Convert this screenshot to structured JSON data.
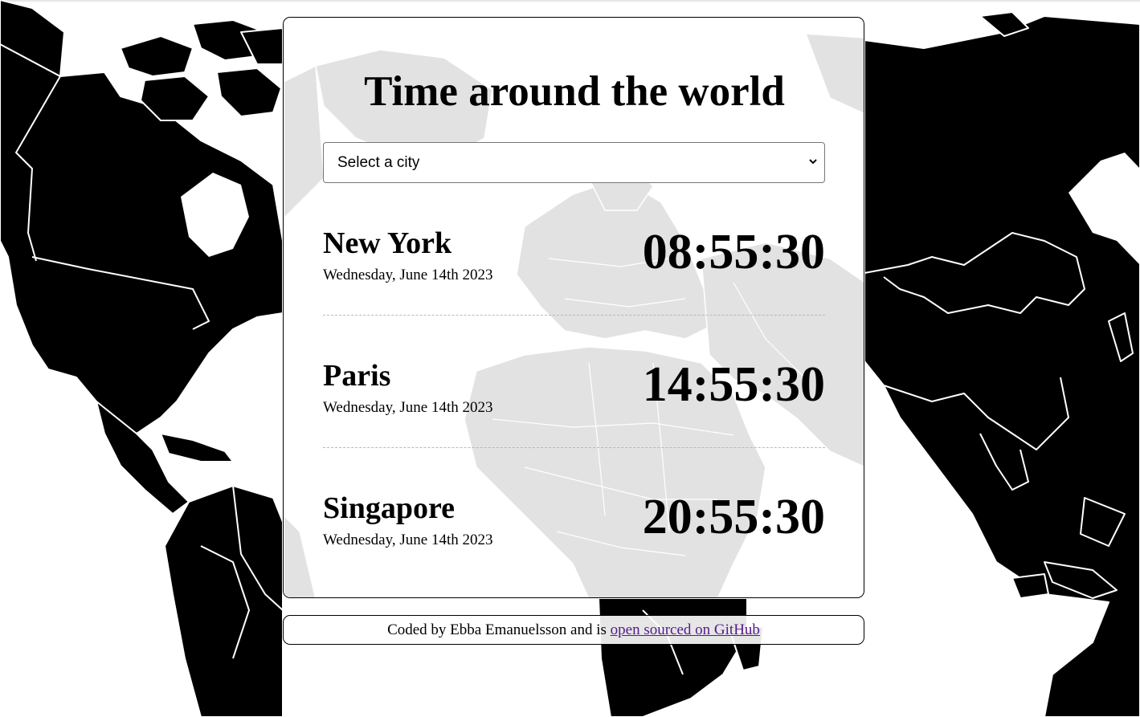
{
  "page": {
    "title": "Time around the world"
  },
  "city_select": {
    "selected": "Select a city"
  },
  "cities": [
    {
      "name": "New York",
      "date": "Wednesday, June 14th 2023",
      "time": "08:55:30"
    },
    {
      "name": "Paris",
      "date": "Wednesday, June 14th 2023",
      "time": "14:55:30"
    },
    {
      "name": "Singapore",
      "date": "Wednesday, June 14th 2023",
      "time": "20:55:30"
    }
  ],
  "footer": {
    "text": "Coded by Ebba Emanuelsson and is",
    "link_text": "open sourced on GitHub"
  },
  "colors": {
    "background_map": "#000000",
    "card_background": "#ffffff",
    "link": "#551a8b",
    "divider": "#b8b8b8"
  },
  "icons": {
    "select_arrow": "chevron-down-icon",
    "background": "world-map-icon"
  }
}
